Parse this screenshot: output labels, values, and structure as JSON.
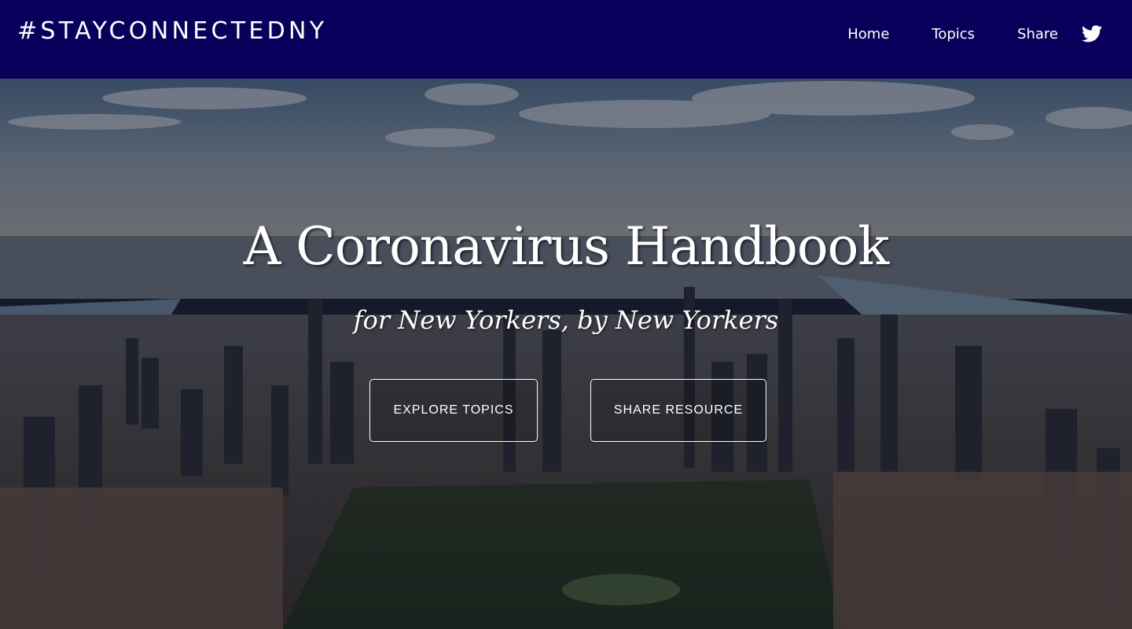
{
  "header": {
    "brand": "#STAYCONNECTEDNY",
    "nav": [
      {
        "label": "Home"
      },
      {
        "label": "Topics"
      },
      {
        "label": "Share"
      }
    ],
    "social_icon": "twitter-icon"
  },
  "hero": {
    "title": "A Coronavirus Handbook",
    "subtitle": "for New Yorkers, by New Yorkers",
    "buttons": {
      "explore": "EXPLORE TOPICS",
      "share": "SHARE RESOURCE"
    },
    "background": "aerial-new-york-city-skyline"
  },
  "colors": {
    "nav_background": "#0a005b",
    "text": "#ffffff"
  }
}
